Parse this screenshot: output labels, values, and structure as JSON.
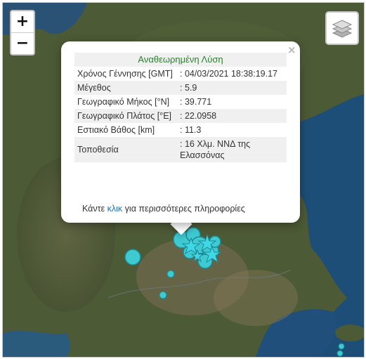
{
  "map": {
    "zoom_in": "+",
    "zoom_out": "−",
    "layers_icon": "layers-icon",
    "colors": {
      "marker_fill": "#3fc9d1",
      "marker_stroke": "#1a8a94",
      "star_fill": "#40d8e6",
      "sea": "#1d4e78",
      "land": "#4a5a34"
    }
  },
  "popup": {
    "header": "Αναθεωρημένη Λύση",
    "close": "×",
    "rows": [
      {
        "label": "Χρόνος Γέννησης [GMT]",
        "value": ": 04/03/2021 18:38:19.17"
      },
      {
        "label": "Μέγεθος",
        "value": ": 5.9"
      },
      {
        "label": "Γεωγραφικό Μήκος [°N]",
        "value": ": 39.771"
      },
      {
        "label": "Γεωγραφικό Πλάτος [°E]",
        "value": ": 22.0958"
      },
      {
        "label": "Εστιακό Βάθος [km]",
        "value": ": 11.3"
      },
      {
        "label": "Τοποθεσία",
        "value": ": 16 Χλμ. ΝΝΔ της Ελασσόνας"
      }
    ],
    "footer_pre": "Κάντε ",
    "footer_link": "κλικ",
    "footer_post": " για περισσότερες πληροφορίες"
  }
}
